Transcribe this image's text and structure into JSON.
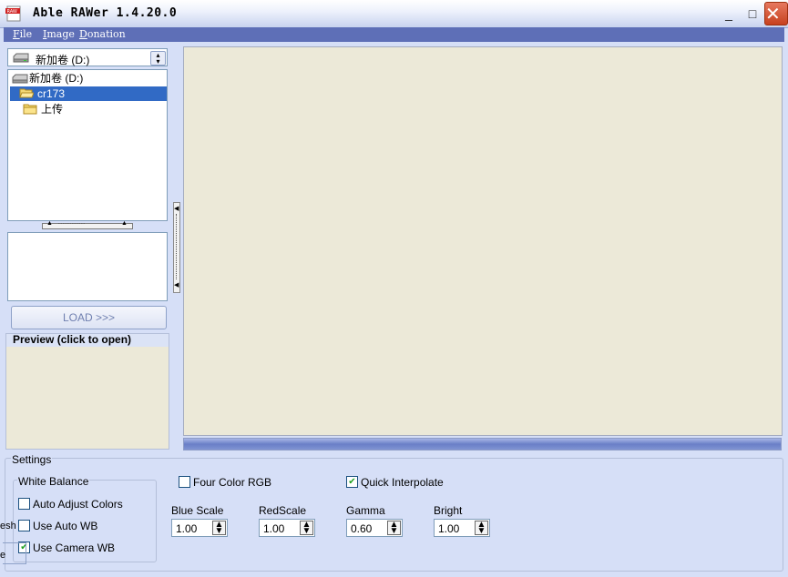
{
  "window": {
    "title": "Able RAWer 1.4.20.0",
    "icon": "raw-app-icon",
    "minimize_glyph": "_",
    "maximize_glyph": "□",
    "close_glyph": "✕"
  },
  "menu": [
    {
      "key": "F",
      "rest": "ile"
    },
    {
      "key": "I",
      "rest": "mage"
    },
    {
      "key": "D",
      "rest": "onation"
    }
  ],
  "drive_select": {
    "value": "新加卷 (D:)"
  },
  "tree": [
    {
      "label": "新加卷 (D:)",
      "icon": "drive-icon",
      "selected": false
    },
    {
      "label": "cr173",
      "icon": "folder-icon",
      "selected": true
    },
    {
      "label": "上传",
      "icon": "folder-icon",
      "selected": false
    }
  ],
  "load_button": "LOAD >>>",
  "preview_title": "Preview (click to open)",
  "settings": {
    "title": "Settings",
    "white_balance": {
      "title": "White Balance",
      "auto_adjust_colors": {
        "label": "Auto Adjust Colors",
        "checked": false
      },
      "use_auto_wb": {
        "label": "Use Auto WB",
        "checked": false
      },
      "use_camera_wb": {
        "label": "Use Camera WB",
        "checked": true
      }
    },
    "four_color_rgb": {
      "label": "Four Color RGB",
      "checked": false
    },
    "quick_interpolate": {
      "label": "Quick Interpolate",
      "checked": true
    },
    "params": [
      {
        "label": "Blue Scale",
        "value": "1.00"
      },
      {
        "label": "RedScale",
        "value": "1.00"
      },
      {
        "label": "Gamma",
        "value": "0.60"
      },
      {
        "label": "Bright",
        "value": "1.00"
      }
    ],
    "fragments": {
      "left_1": "esh",
      "left_2": "e"
    }
  },
  "colors": {
    "menubar": "#5e6fb7",
    "selection": "#316ac5",
    "panel_bg": "#d6dff7",
    "canvas_bg": "#ece9d8"
  }
}
